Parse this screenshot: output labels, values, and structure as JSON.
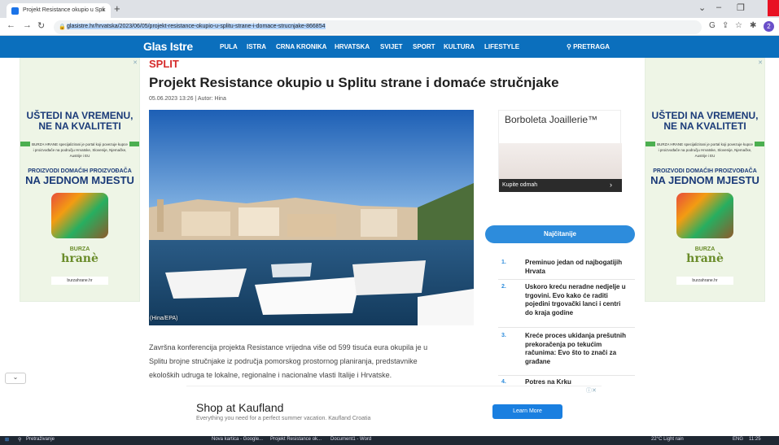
{
  "browser": {
    "tab_title": "Projekt Resistance okupio u Spli",
    "new_tab": "+",
    "url": "glasistre.hr/hrvatska/2023/06/05/projekt-resistance-okupio-u-splitu-strane-i-domace-strucnjake-866854"
  },
  "site": {
    "logo": "Glas Istre",
    "nav": [
      "PULA",
      "ISTRA",
      "CRNA KRONIKA",
      "HRVATSKA",
      "SVIJET",
      "SPORT",
      "KULTURA",
      "LIFESTYLE"
    ],
    "search": "PRETRAGA"
  },
  "article": {
    "section": "SPLIT",
    "title": "Projekt Resistance okupio u Splitu strane i domaće stručnjake",
    "meta": "05.06.2023 13:26 | Autor: Hina",
    "photo_credit": "(Hina/EPA)",
    "lines": [
      "Završna konferencija projekta Resistance vrijedna više od 599 tisuća eura okupila je u",
      "Splitu brojne stručnjake iz područja pomorskog prostornog planiranja, predstavnike",
      "ekoloških udruga te lokalne, regionalne i nacionalne vlasti Italije i Hrvatske."
    ]
  },
  "side_ad": {
    "headline": "UŠTEDI NA VREMENU, NE NA KVALITETI",
    "small": "BURZA HRANE specijalizirani je portal koji povezuje kupce i proizvođače na području Hrvatske, Slovenije, Njemačke, Austrije i EU",
    "sub1": "PROIZVODI DOMAĆIH PROIZVOĐAČA",
    "sub2": "NA JEDNOM MJESTU",
    "brand": "hranè",
    "brand_top": "BURZA",
    "site": "burzahrane.hr"
  },
  "brand_ad": {
    "name": "Borboleta Joaillerie™",
    "cta": "Kupite odmah",
    "arrow": "›"
  },
  "most_read": {
    "label": "Najčitanije",
    "items": [
      {
        "num": "1.",
        "text": "Preminuo jedan od najbogatijih Hrvata"
      },
      {
        "num": "2.",
        "text": "Uskoro kreću neradne nedjelje u trgovini. Evo kako će raditi pojedini trgovački lanci i centri do kraja godine"
      },
      {
        "num": "3.",
        "text": "Kreće proces ukidanja prešutnih prekoračenja po tekućim računima: Evo što to znači za građane"
      },
      {
        "num": "4.",
        "text": "Potres na Krku"
      }
    ]
  },
  "bottom_ad": {
    "title": "Shop at Kaufland",
    "subtitle": "Everything you need for a perfect summer vacation. Kaufland Croatia",
    "button": "Learn More"
  },
  "taskbar": {
    "search": "Pretraživanje",
    "apps": [
      "Nova kartica - Google...",
      "Projekt Resistance ok...",
      "Document1 - Word"
    ],
    "weather": "22°C  Light rain",
    "lang": "ENG",
    "time": "11:25"
  },
  "colors": {
    "brand_blue": "#0b6fbd",
    "section_red": "#d62b2b",
    "accent_blue": "#2d8cdc"
  }
}
